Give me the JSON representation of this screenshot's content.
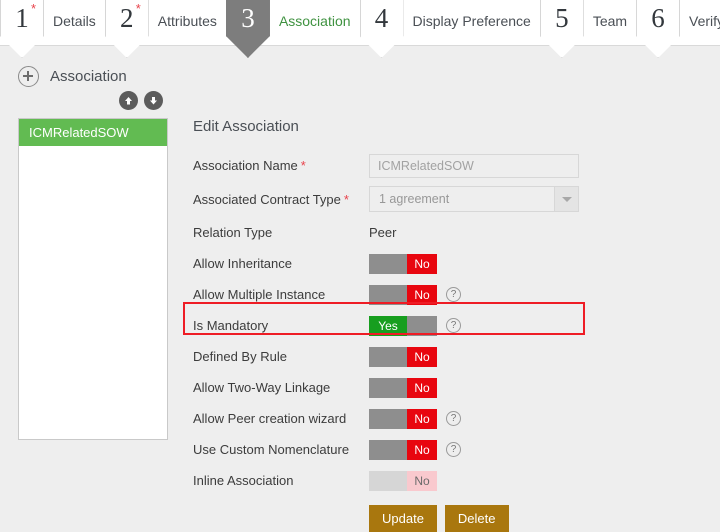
{
  "wizard": {
    "steps": [
      {
        "num": "1",
        "label": "Details",
        "required": true,
        "active": false
      },
      {
        "num": "2",
        "label": "Attributes",
        "required": true,
        "active": false
      },
      {
        "num": "3",
        "label": "Association",
        "required": false,
        "active": true
      },
      {
        "num": "4",
        "label": "Display Preference",
        "required": false,
        "active": false
      },
      {
        "num": "5",
        "label": "Team",
        "required": false,
        "active": false
      },
      {
        "num": "6",
        "label": "Verify",
        "required": false,
        "active": false
      }
    ]
  },
  "section": {
    "header": "Association",
    "add_icon": "circle-plus-icon",
    "move_up_icon": "arrow-up-circle-icon",
    "move_down_icon": "arrow-down-circle-icon"
  },
  "list": {
    "items": [
      {
        "label": "ICMRelatedSOW",
        "selected": true
      }
    ]
  },
  "form": {
    "title": "Edit Association",
    "association_name": {
      "label": "Association Name",
      "required_marker": "*",
      "value": "ICMRelatedSOW"
    },
    "contract_type": {
      "label": "Associated Contract Type",
      "required_marker": "*",
      "value": "1  agreement",
      "dropdown_icon": "chevron-down-icon"
    },
    "relation_type": {
      "label": "Relation Type",
      "value": "Peer"
    },
    "toggles": [
      {
        "label": "Allow Inheritance",
        "state": "No",
        "help": false,
        "disabled": false
      },
      {
        "label": "Allow Multiple Instance",
        "state": "No",
        "help": true,
        "disabled": false
      },
      {
        "label": "Is Mandatory",
        "state": "Yes",
        "help": true,
        "disabled": false
      },
      {
        "label": "Defined By Rule",
        "state": "No",
        "help": false,
        "disabled": false
      },
      {
        "label": "Allow Two-Way Linkage",
        "state": "No",
        "help": false,
        "disabled": false
      },
      {
        "label": "Allow Peer creation wizard",
        "state": "No",
        "help": true,
        "disabled": false
      },
      {
        "label": "Use Custom Nomenclature",
        "state": "No",
        "help": true,
        "disabled": false
      },
      {
        "label": "Inline Association",
        "state": "No",
        "help": false,
        "disabled": true
      }
    ],
    "help_icon_glyph": "?",
    "buttons": {
      "update": "Update",
      "delete": "Delete"
    }
  },
  "annotation": {
    "target": "Is Mandatory",
    "color": "#ee1c25"
  },
  "colors": {
    "page_bg": "#eeeeee",
    "accent_green": "#62bb52",
    "active_step": "#7d7d7d",
    "toggle_on": "#179e1f",
    "toggle_off": "#e8060f",
    "toggle_track": "#8e8e8e",
    "button_gold": "#a9770e",
    "required_red": "#e8424b",
    "current_step_label": "#3f9240"
  }
}
